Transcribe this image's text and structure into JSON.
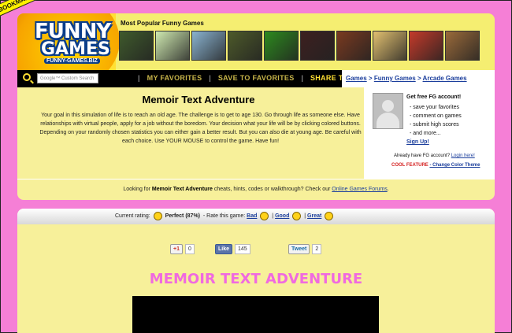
{
  "bookmark": "BOOKMARK FUNNY-GAMES.BIZ",
  "logo": {
    "line1": "FUNNY",
    "line2": "GAMES",
    "tagline": "FUNNY-GAMES.BIZ"
  },
  "popular_label": "Most Popular Funny Games",
  "thumbnails": [
    {
      "color": "#3f5a2c"
    },
    {
      "color": "#cfe9b0"
    },
    {
      "color": "#8ab3d0"
    },
    {
      "color": "#4d5a2a"
    },
    {
      "color": "#2d8a1e"
    },
    {
      "color": "#3d2020"
    },
    {
      "color": "#7a3a20"
    },
    {
      "color": "#e2c070"
    },
    {
      "color": "#c43a2a"
    },
    {
      "color": "#9a6a3a"
    }
  ],
  "nav": {
    "search_placeholder": "Google™ Custom Search",
    "my_favorites": "MY FAVORITES",
    "save_favorites": "SAVE TO FAVORITES",
    "share": "SHARE THIS GAME",
    "breadcrumb": [
      "Games",
      "Funny Games",
      "Arcade Games"
    ]
  },
  "game": {
    "title": "Memoir Text Adventure",
    "description": "Your goal in this simulation of life is to reach an old age. The challenge is to get to age 130. Go through life as someone else. Have relationships with virtual people, apply for a job without the boredom. Your decision what your life will be by clicking colored buttons. Depending on your randomly chosen statistics you can either gain a better result. But you can also die at young age. Be careful with each choice. Use YOUR MOUSE to control the game. Have fun!",
    "heading": "MEMOIR TEXT ADVENTURE"
  },
  "account": {
    "title": "Get free FG account!",
    "benefits": [
      "- save your favorites",
      "- comment on games",
      "- submit high scores",
      "- and more..."
    ],
    "signup": "Sign Up!",
    "already": "Already have FG account?",
    "login": "Login here!",
    "cool": "COOL FEATURE",
    "change_color": "- Change Color Theme"
  },
  "looking": {
    "prefix": "Looking for",
    "game": "Memoir Text Adventure",
    "middle": "cheats, hints, codes or walkthrough? Check our",
    "link": "Online Games Forums",
    "suffix": "."
  },
  "rating": {
    "label": "Current rating:",
    "value": "Perfect (87%)",
    "rate_label": "- Rate this game:",
    "bad": "Bad",
    "good": "Good",
    "great": "Great"
  },
  "social": {
    "gplus": "+1",
    "gplus_count": "0",
    "like": "Like",
    "like_count": "145",
    "tweet": "Tweet",
    "tweet_count": "2"
  }
}
